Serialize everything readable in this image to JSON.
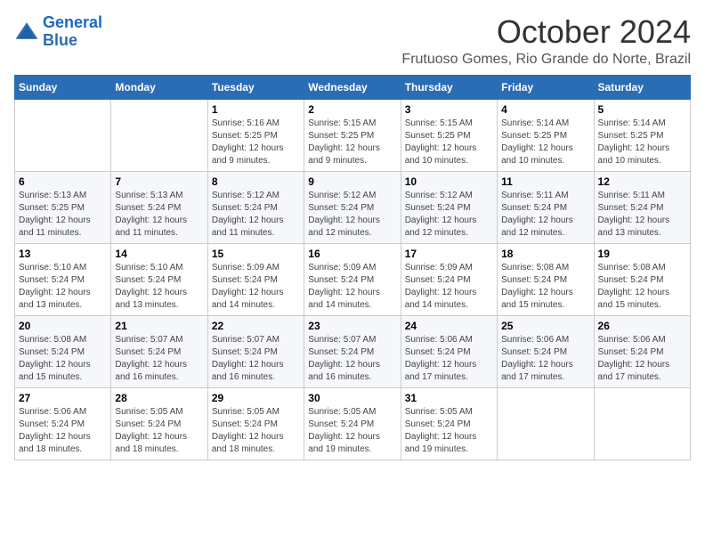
{
  "logo": {
    "text_general": "General",
    "text_blue": "Blue"
  },
  "header": {
    "month": "October 2024",
    "location": "Frutuoso Gomes, Rio Grande do Norte, Brazil"
  },
  "days_of_week": [
    "Sunday",
    "Monday",
    "Tuesday",
    "Wednesday",
    "Thursday",
    "Friday",
    "Saturday"
  ],
  "weeks": [
    [
      {
        "day": "",
        "info": ""
      },
      {
        "day": "",
        "info": ""
      },
      {
        "day": "1",
        "info": "Sunrise: 5:16 AM\nSunset: 5:25 PM\nDaylight: 12 hours\nand 9 minutes."
      },
      {
        "day": "2",
        "info": "Sunrise: 5:15 AM\nSunset: 5:25 PM\nDaylight: 12 hours\nand 9 minutes."
      },
      {
        "day": "3",
        "info": "Sunrise: 5:15 AM\nSunset: 5:25 PM\nDaylight: 12 hours\nand 10 minutes."
      },
      {
        "day": "4",
        "info": "Sunrise: 5:14 AM\nSunset: 5:25 PM\nDaylight: 12 hours\nand 10 minutes."
      },
      {
        "day": "5",
        "info": "Sunrise: 5:14 AM\nSunset: 5:25 PM\nDaylight: 12 hours\nand 10 minutes."
      }
    ],
    [
      {
        "day": "6",
        "info": "Sunrise: 5:13 AM\nSunset: 5:25 PM\nDaylight: 12 hours\nand 11 minutes."
      },
      {
        "day": "7",
        "info": "Sunrise: 5:13 AM\nSunset: 5:24 PM\nDaylight: 12 hours\nand 11 minutes."
      },
      {
        "day": "8",
        "info": "Sunrise: 5:12 AM\nSunset: 5:24 PM\nDaylight: 12 hours\nand 11 minutes."
      },
      {
        "day": "9",
        "info": "Sunrise: 5:12 AM\nSunset: 5:24 PM\nDaylight: 12 hours\nand 12 minutes."
      },
      {
        "day": "10",
        "info": "Sunrise: 5:12 AM\nSunset: 5:24 PM\nDaylight: 12 hours\nand 12 minutes."
      },
      {
        "day": "11",
        "info": "Sunrise: 5:11 AM\nSunset: 5:24 PM\nDaylight: 12 hours\nand 12 minutes."
      },
      {
        "day": "12",
        "info": "Sunrise: 5:11 AM\nSunset: 5:24 PM\nDaylight: 12 hours\nand 13 minutes."
      }
    ],
    [
      {
        "day": "13",
        "info": "Sunrise: 5:10 AM\nSunset: 5:24 PM\nDaylight: 12 hours\nand 13 minutes."
      },
      {
        "day": "14",
        "info": "Sunrise: 5:10 AM\nSunset: 5:24 PM\nDaylight: 12 hours\nand 13 minutes."
      },
      {
        "day": "15",
        "info": "Sunrise: 5:09 AM\nSunset: 5:24 PM\nDaylight: 12 hours\nand 14 minutes."
      },
      {
        "day": "16",
        "info": "Sunrise: 5:09 AM\nSunset: 5:24 PM\nDaylight: 12 hours\nand 14 minutes."
      },
      {
        "day": "17",
        "info": "Sunrise: 5:09 AM\nSunset: 5:24 PM\nDaylight: 12 hours\nand 14 minutes."
      },
      {
        "day": "18",
        "info": "Sunrise: 5:08 AM\nSunset: 5:24 PM\nDaylight: 12 hours\nand 15 minutes."
      },
      {
        "day": "19",
        "info": "Sunrise: 5:08 AM\nSunset: 5:24 PM\nDaylight: 12 hours\nand 15 minutes."
      }
    ],
    [
      {
        "day": "20",
        "info": "Sunrise: 5:08 AM\nSunset: 5:24 PM\nDaylight: 12 hours\nand 15 minutes."
      },
      {
        "day": "21",
        "info": "Sunrise: 5:07 AM\nSunset: 5:24 PM\nDaylight: 12 hours\nand 16 minutes."
      },
      {
        "day": "22",
        "info": "Sunrise: 5:07 AM\nSunset: 5:24 PM\nDaylight: 12 hours\nand 16 minutes."
      },
      {
        "day": "23",
        "info": "Sunrise: 5:07 AM\nSunset: 5:24 PM\nDaylight: 12 hours\nand 16 minutes."
      },
      {
        "day": "24",
        "info": "Sunrise: 5:06 AM\nSunset: 5:24 PM\nDaylight: 12 hours\nand 17 minutes."
      },
      {
        "day": "25",
        "info": "Sunrise: 5:06 AM\nSunset: 5:24 PM\nDaylight: 12 hours\nand 17 minutes."
      },
      {
        "day": "26",
        "info": "Sunrise: 5:06 AM\nSunset: 5:24 PM\nDaylight: 12 hours\nand 17 minutes."
      }
    ],
    [
      {
        "day": "27",
        "info": "Sunrise: 5:06 AM\nSunset: 5:24 PM\nDaylight: 12 hours\nand 18 minutes."
      },
      {
        "day": "28",
        "info": "Sunrise: 5:05 AM\nSunset: 5:24 PM\nDaylight: 12 hours\nand 18 minutes."
      },
      {
        "day": "29",
        "info": "Sunrise: 5:05 AM\nSunset: 5:24 PM\nDaylight: 12 hours\nand 18 minutes."
      },
      {
        "day": "30",
        "info": "Sunrise: 5:05 AM\nSunset: 5:24 PM\nDaylight: 12 hours\nand 19 minutes."
      },
      {
        "day": "31",
        "info": "Sunrise: 5:05 AM\nSunset: 5:24 PM\nDaylight: 12 hours\nand 19 minutes."
      },
      {
        "day": "",
        "info": ""
      },
      {
        "day": "",
        "info": ""
      }
    ]
  ]
}
